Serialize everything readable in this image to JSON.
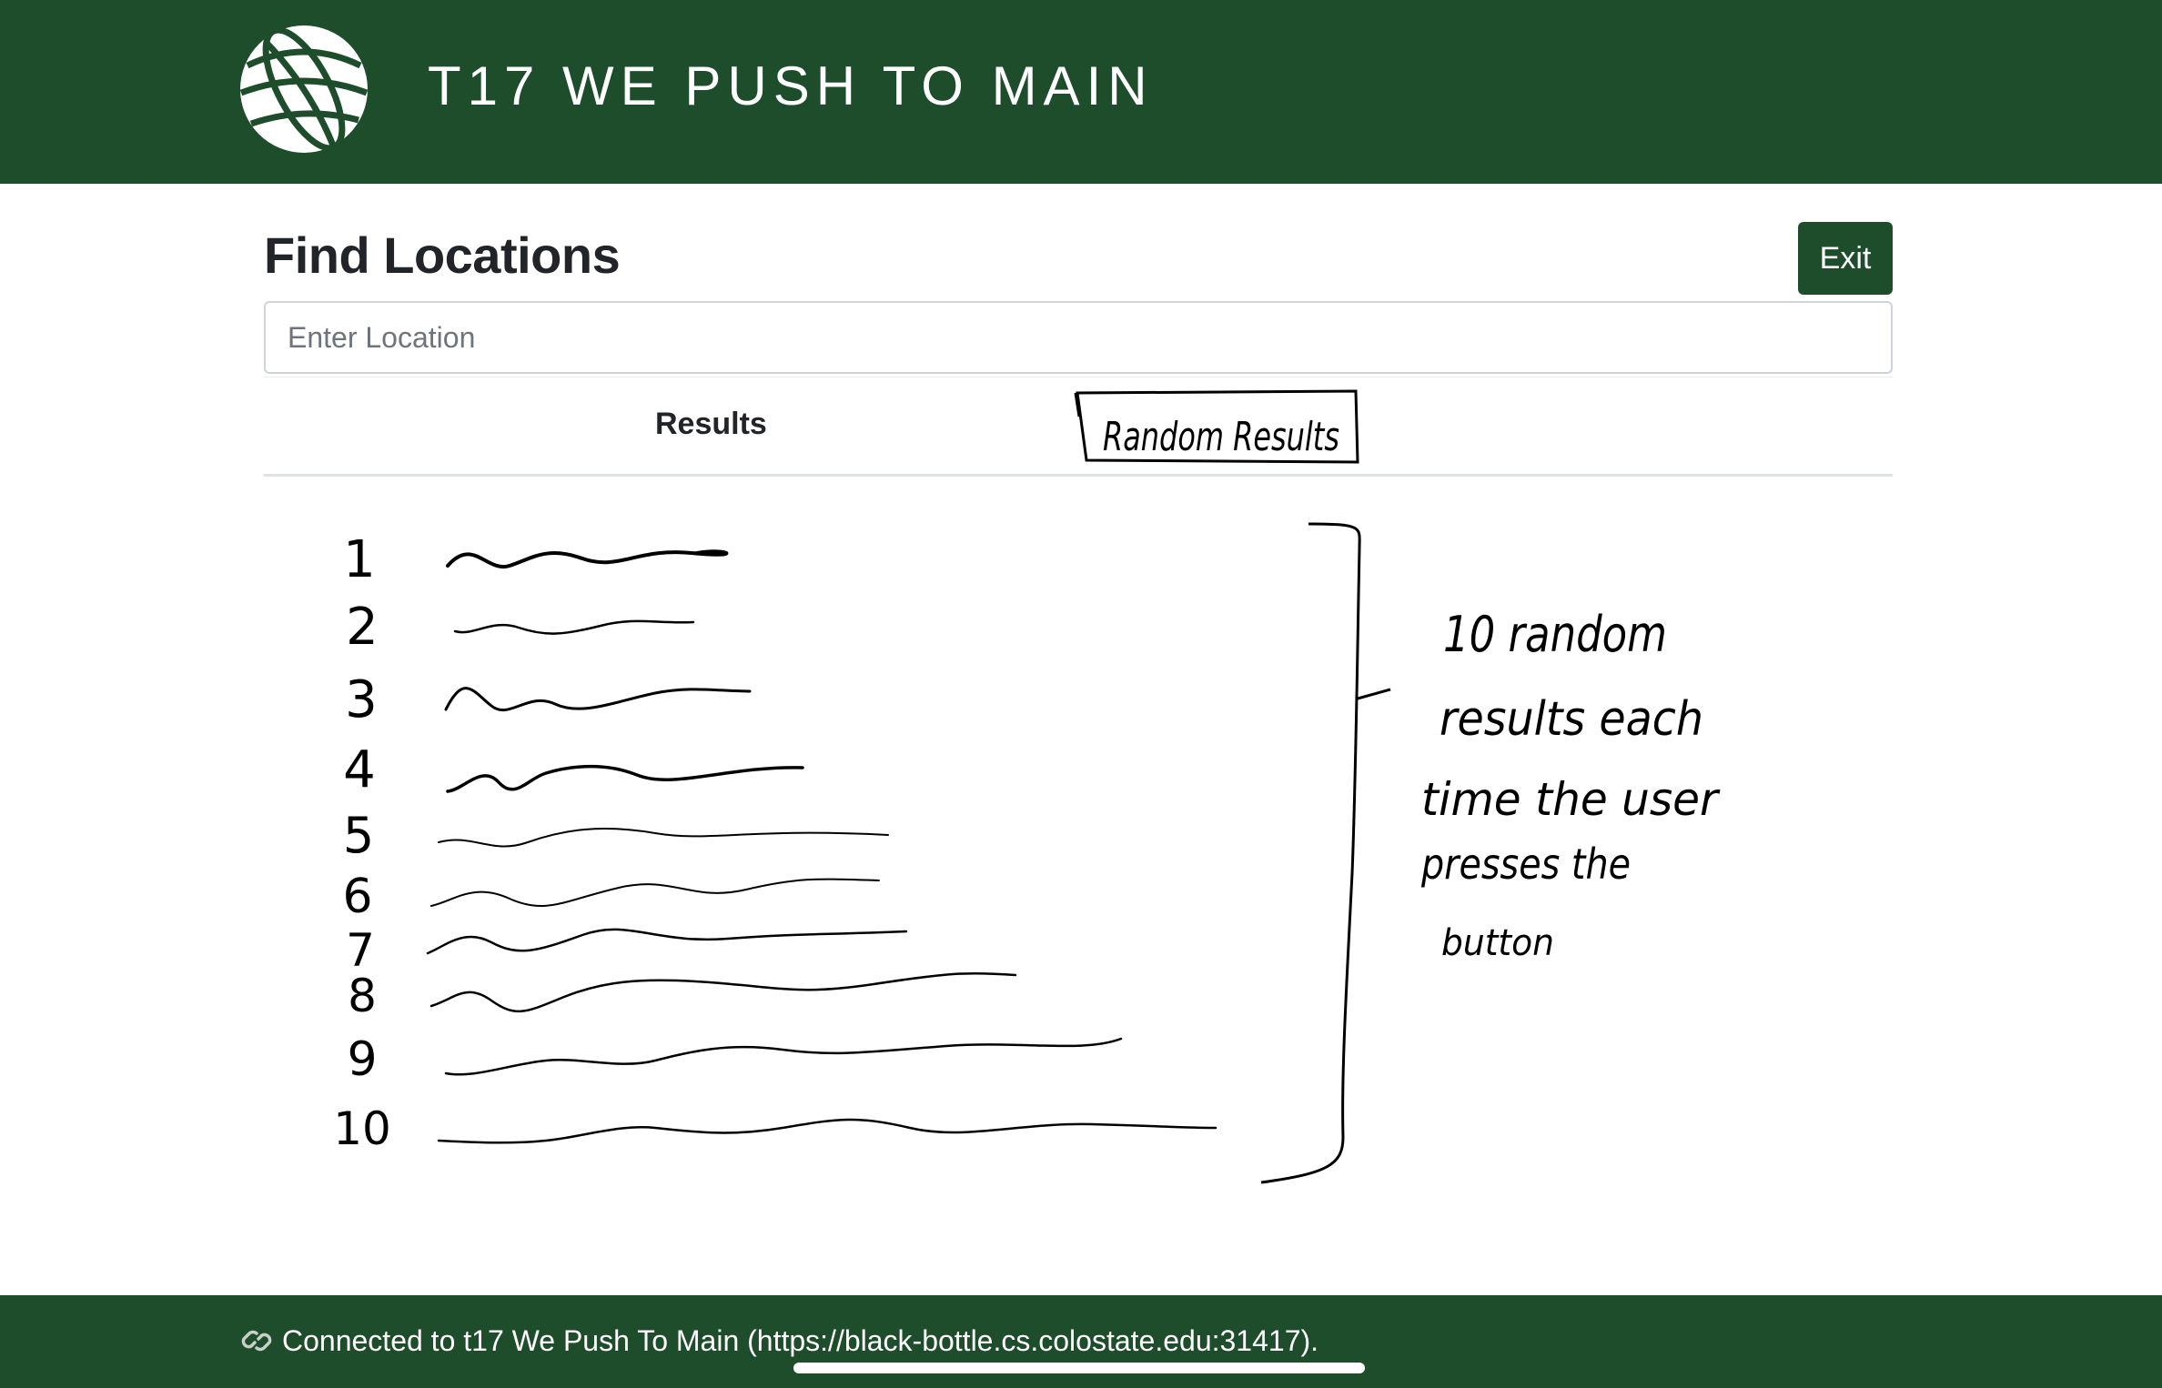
{
  "header": {
    "title": "T17 WE PUSH TO MAIN",
    "logo_icon": "globe-icon"
  },
  "main": {
    "title": "Find Locations",
    "exit_label": "Exit",
    "search": {
      "placeholder": "Enter Location",
      "value": ""
    },
    "tabs": [
      {
        "label": "Results"
      },
      {
        "label": "Random Results"
      }
    ],
    "result_numbers": [
      "1",
      "2",
      "3",
      "4",
      "5",
      "6",
      "7",
      "8",
      "9",
      "10"
    ],
    "annotation_lines": [
      "10 random",
      "results each",
      "time the user",
      "presses the",
      "button"
    ]
  },
  "footer": {
    "status": "Connected to t17 We Push To Main  (https://black-bottle.cs.colostate.edu:31417).",
    "icon": "link-icon"
  },
  "colors": {
    "brand": "#1e4d2b",
    "ink": "#000000"
  }
}
